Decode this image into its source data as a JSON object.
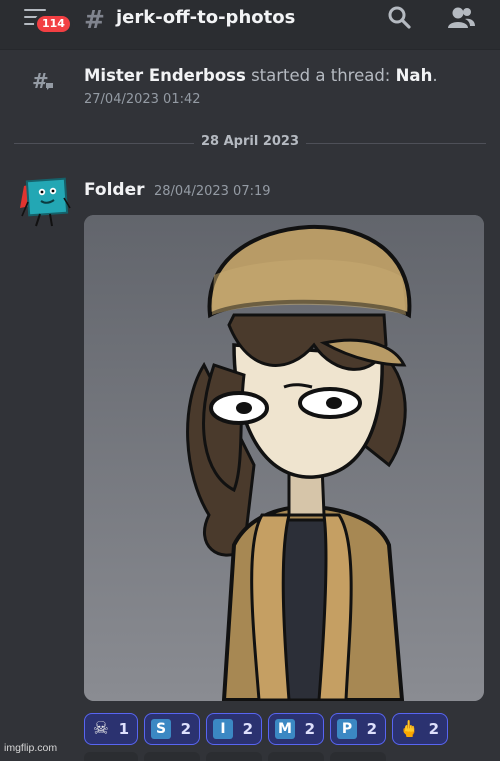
{
  "header": {
    "unread_badge": "114",
    "channel_name": "jerk-off-to-photos",
    "icons": [
      "hamburger-menu-icon",
      "hash-icon",
      "search-icon",
      "members-icon"
    ]
  },
  "system_message": {
    "author": "Mister Enderboss",
    "action": "started a thread:",
    "thread_name": "Nah",
    "period": ".",
    "timestamp": "27/04/2023 01:42",
    "icon": "thread-icon"
  },
  "date_divider": "28 April 2023",
  "message": {
    "author": "Folder",
    "timestamp": "28/04/2023 07:19",
    "attachment": "image-attachment"
  },
  "reactions": [
    {
      "emoji": "skull-and-crossbones-icon",
      "glyph": "☠",
      "count": "1"
    },
    {
      "emoji": "letter-s-icon",
      "glyph": "S",
      "count": "2"
    },
    {
      "emoji": "letter-i-icon",
      "glyph": "I",
      "count": "2"
    },
    {
      "emoji": "letter-m-icon",
      "glyph": "M",
      "count": "2"
    },
    {
      "emoji": "letter-p-icon",
      "glyph": "P",
      "count": "2"
    },
    {
      "emoji": "middle-finger-icon",
      "glyph": "🖕",
      "count": "2"
    }
  ],
  "watermark": "imgflip.com",
  "colors": {
    "background": "#313338",
    "header": "#2b2d31",
    "badge": "#f23f43",
    "reaction_bg": "#2b3270",
    "reaction_border": "#5865f2",
    "letter_emoji": "#3b88c3"
  }
}
